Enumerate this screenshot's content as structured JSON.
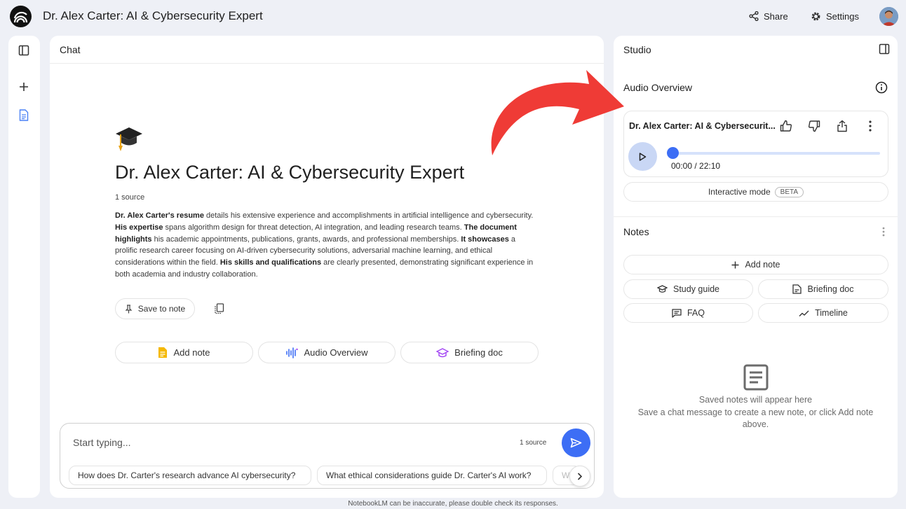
{
  "app": {
    "title": "Dr. Alex Carter: AI & Cybersecurity Expert",
    "share_label": "Share",
    "settings_label": "Settings"
  },
  "chat": {
    "panel_title": "Chat",
    "heading": "Dr. Alex Carter: AI & Cybersecurity Expert",
    "source_count": "1 source",
    "summary": [
      {
        "b": "Dr. Alex Carter's resume",
        "t": " details his extensive experience and accomplishments in artificial intelligence and cybersecurity. "
      },
      {
        "b": "His expertise",
        "t": " spans algorithm design for threat detection, AI integration, and leading research teams. "
      },
      {
        "b": "The document highlights",
        "t": " his academic appointments, publications, grants, awards, and professional memberships. "
      },
      {
        "b": "It showcases",
        "t": " a prolific research career focusing on AI-driven cybersecurity solutions, adversarial machine learning, and ethical considerations within the field. "
      },
      {
        "b": "His skills and qualifications",
        "t": " are clearly presented, demonstrating significant experience in both academia and industry collaboration."
      }
    ],
    "save_to_note": "Save to note",
    "actions": {
      "add_note": "Add note",
      "audio_overview": "Audio Overview",
      "briefing_doc": "Briefing doc"
    },
    "input_placeholder": "Start typing...",
    "input_source_count": "1 source",
    "suggestions": [
      "How does Dr. Carter's research advance AI cybersecurity?",
      "What ethical considerations guide Dr. Carter's AI work?",
      "W"
    ]
  },
  "studio": {
    "panel_title": "Studio",
    "audio_overview_title": "Audio Overview",
    "audio_item_title": "Dr. Alex Carter: AI & Cybersecurit...",
    "audio_time": "00:00 / 22:10",
    "audio_progress": 0,
    "interactive_mode": "Interactive mode",
    "beta_badge": "BETA",
    "notes_title": "Notes",
    "add_note": "Add note",
    "study_guide": "Study guide",
    "briefing_doc": "Briefing doc",
    "faq": "FAQ",
    "timeline": "Timeline",
    "empty_title": "Saved notes will appear here",
    "empty_text": "Save a chat message to create a new note, or click Add note above."
  },
  "footer": "NotebookLM can be inaccurate, please double check its responses.",
  "colors": {
    "accent_blue": "#3d6ef5",
    "arrow_red": "#ef3b36",
    "page_bg": "#eef0f6",
    "doc_icon_yellow": "#f5b800",
    "briefing_purple": "#a142f4"
  }
}
